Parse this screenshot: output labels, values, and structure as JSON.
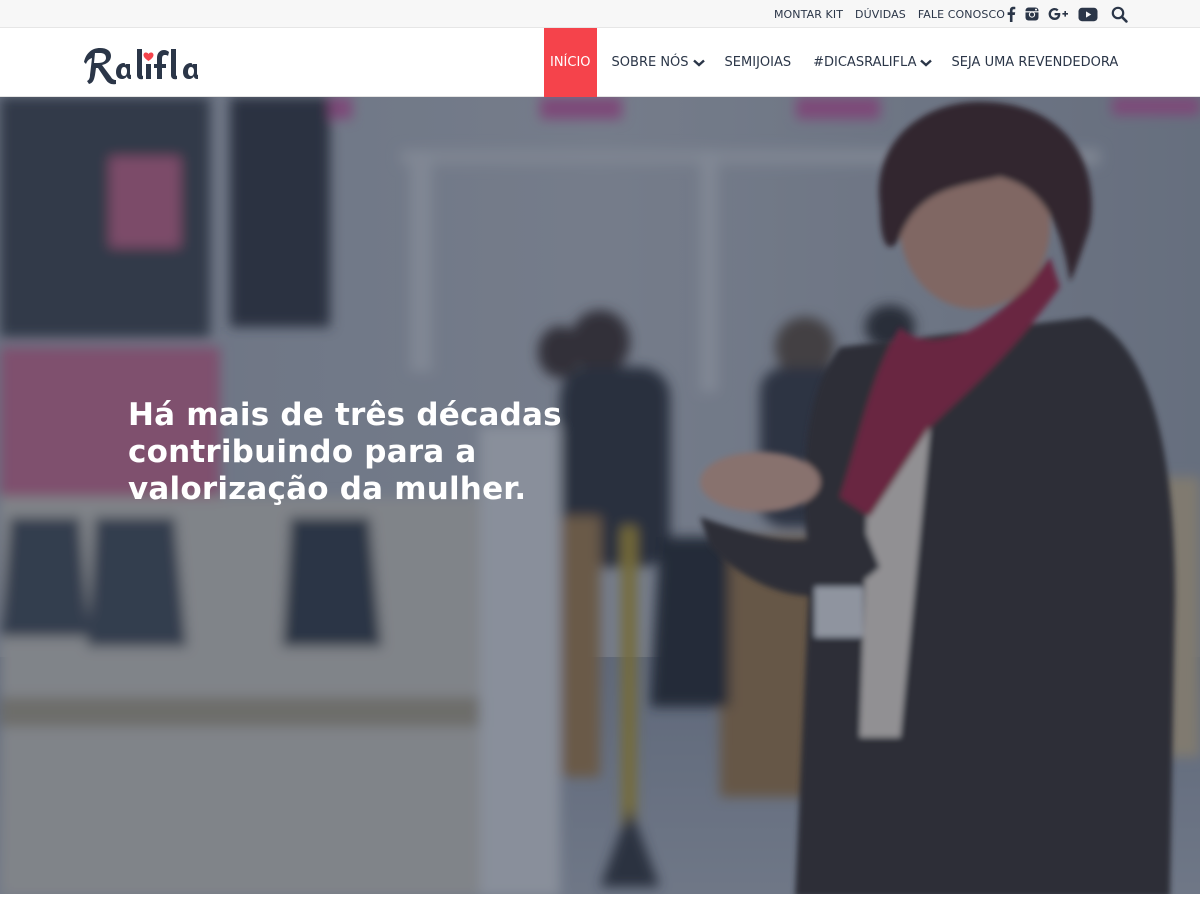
{
  "brand": {
    "name": "Ralifla",
    "accent": "#f5434b",
    "navy": "#2b3648"
  },
  "topbar": {
    "links": [
      "MONTAR KIT",
      "DÚVIDAS",
      "FALE CONOSCO"
    ],
    "icons": [
      "facebook-icon",
      "instagram-icon",
      "google-plus-icon",
      "youtube-icon",
      "search-icon"
    ]
  },
  "nav": {
    "items": [
      {
        "label": "INÍCIO",
        "active": true,
        "dropdown": false
      },
      {
        "label": "SOBRE NÓS",
        "active": false,
        "dropdown": true
      },
      {
        "label": "SEMIJOIAS",
        "active": false,
        "dropdown": false
      },
      {
        "label": "#DICASRALIFLA",
        "active": false,
        "dropdown": true
      },
      {
        "label": "SEJA UMA REVENDEDORA",
        "active": false,
        "dropdown": false
      }
    ]
  },
  "hero": {
    "title_lines": [
      "Há mais de três décadas",
      "contribuindo para a",
      "valorização da mulher."
    ]
  }
}
